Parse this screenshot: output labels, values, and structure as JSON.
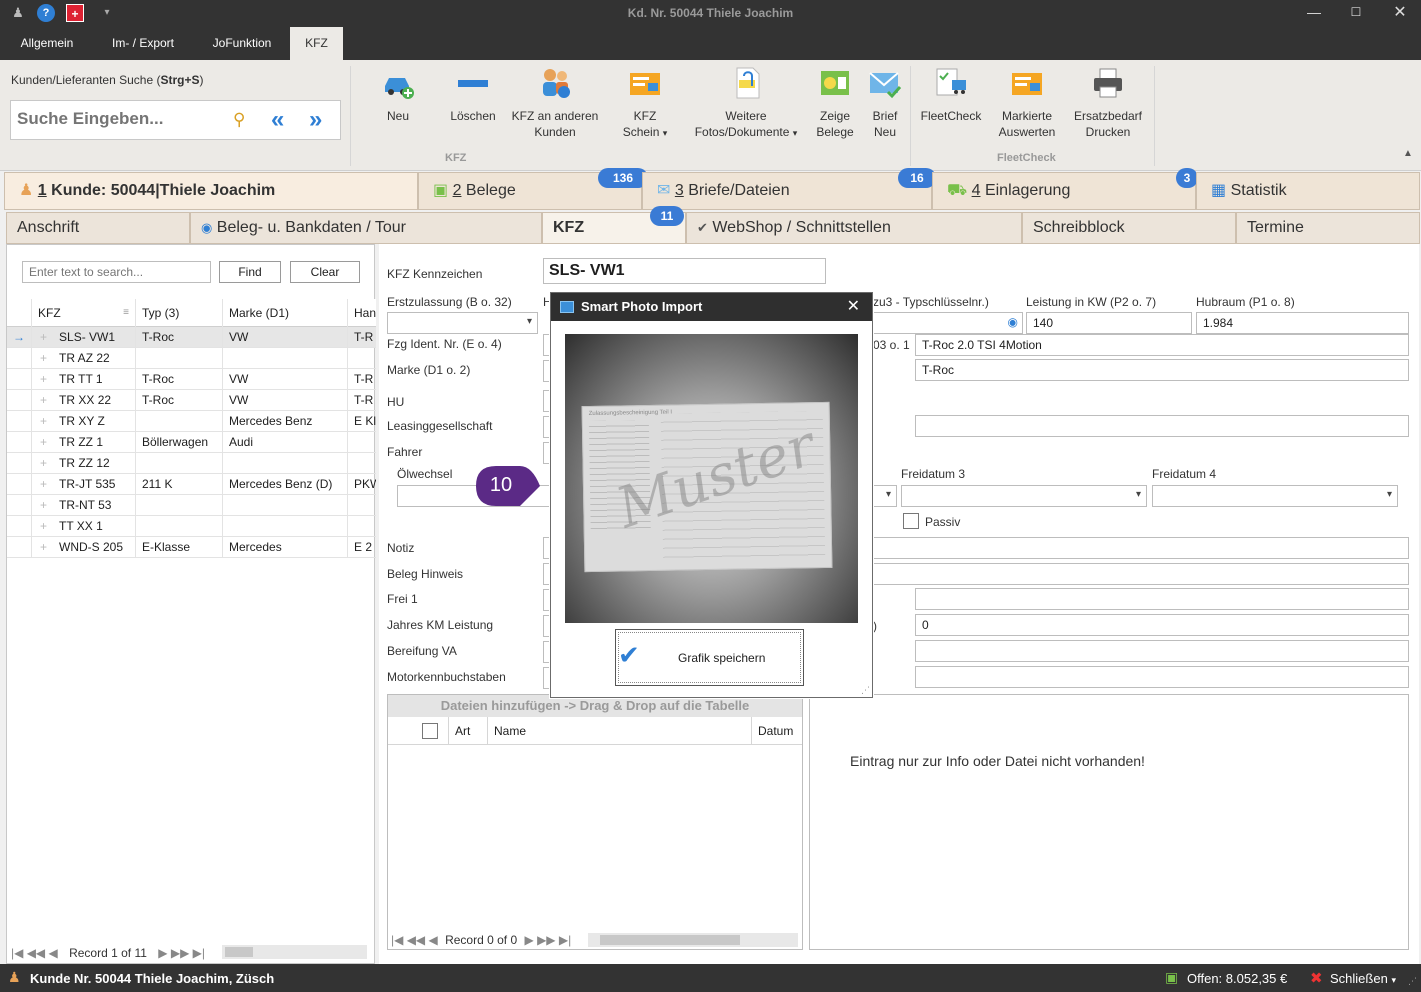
{
  "window": {
    "title": "Kd. Nr. 50044 Thiele Joachim"
  },
  "menu": {
    "tabs": [
      "Allgemein",
      "Im- / Export",
      "JoFunktion",
      "KFZ"
    ]
  },
  "ribbon": {
    "search_label_prefix": "Kunden/Lieferanten Suche (",
    "search_label_shortcut": "Strg+S",
    "search_label_suffix": ")",
    "search_placeholder": "Suche Eingeben...",
    "kfz_group": "KFZ",
    "fleet_group": "FleetCheck",
    "buttons": {
      "neu": "Neu",
      "loeschen": "Löschen",
      "kfz_an1": "KFZ an anderen",
      "kfz_an2": "Kunden",
      "schein": "KFZ Schein",
      "weitere1": "Weitere",
      "weitere2": "Fotos/Dokumente",
      "zeige1": "Zeige",
      "zeige2": "Belege",
      "brief1": "Brief",
      "brief2": "Neu",
      "fleetcheck": "FleetCheck",
      "markierte1": "Markierte",
      "markierte2": "Auswerten",
      "ersatz1": "Ersatzbedarf",
      "ersatz2": "Drucken"
    }
  },
  "main_tabs": {
    "kunde_num": "1",
    "kunde_text": " Kunde: 50044|Thiele Joachim",
    "belege_num": "2",
    "belege_text": " Belege",
    "belege_badge": "136",
    "briefe_num": "3",
    "briefe_text": " Briefe/Dateien",
    "briefe_badge": "16",
    "einl_num": "4",
    "einl_text": " Einlagerung",
    "einl_badge": "3",
    "statistik": "Statistik"
  },
  "sub_tabs": {
    "anschrift": "Anschrift",
    "beleg": "Beleg- u. Bankdaten / Tour",
    "kfz": "KFZ",
    "kfz_badge": "11",
    "webshop": "WebShop / Schnittstellen",
    "schreibblock": "Schreibblock",
    "termine": "Termine"
  },
  "left_panel": {
    "search_placeholder": "Enter text to search...",
    "find": "Find",
    "clear": "Clear",
    "columns": [
      "KFZ",
      "Typ (3)",
      "Marke (D1)",
      "Han"
    ],
    "rows": [
      [
        "SLS- VW1",
        "T-Roc",
        "VW",
        "T-R"
      ],
      [
        "TR AZ 22",
        "",
        "",
        ""
      ],
      [
        "TR TT 1",
        "T-Roc",
        "VW",
        "T-R"
      ],
      [
        "TR XX 22",
        "T-Roc",
        "VW",
        "T-R"
      ],
      [
        "TR XY Z",
        "",
        "Mercedes Benz",
        "E Kl"
      ],
      [
        "TR ZZ 1",
        "Böllerwagen",
        "Audi",
        ""
      ],
      [
        "TR ZZ 12",
        "",
        "",
        ""
      ],
      [
        "TR-JT 535",
        "211 K",
        "Mercedes Benz (D)",
        "PKW"
      ],
      [
        "TR-NT 53",
        "",
        "",
        ""
      ],
      [
        "TT XX 1",
        "",
        "",
        ""
      ],
      [
        "WND-S 205",
        "E-Klasse",
        "Mercedes",
        "E 2"
      ]
    ],
    "record_nav": "Record 1 of 11"
  },
  "form": {
    "kennzeichen_label": "KFZ Kennzeichen",
    "kennzeichen": "SLS- VW1",
    "erstzulassung_label": "Erstzulassung (B o. 32)",
    "h_label": "H",
    "typschluessel_label": "zu3 - Typschlüsselnr.)",
    "leistung_label": "Leistung in KW (P2 o. 7)",
    "leistung": "140",
    "hubraum_label": "Hubraum (P1 o. 8)",
    "hubraum": "1.984",
    "fzg_label": "Fzg Ident. Nr. (E o. 4)",
    "d3_label": "03 o. 1",
    "d3_value": "T-Roc 2.0 TSI 4Motion",
    "marke_label": "Marke (D1 o. 2)",
    "marke_right": "T-Roc",
    "hu_label": "HU",
    "leasing_label": "Leasinggesellschaft",
    "fahrer_label": "Fahrer",
    "oelwechsel_label": "Ölwechsel",
    "freidatum3_label": "Freidatum 3",
    "freidatum4_label": "Freidatum 4",
    "passiv_label": "Passiv",
    "notiz_label": "Notiz",
    "beleg_hinweis_label": "Beleg Hinweis",
    "frei1_label": "Frei 1",
    "jahres_km_label": "Jahres KM Leistung",
    "jahres_km_right_label": ")",
    "jahres_km_right": "0",
    "bereifung_label": "Bereifung VA",
    "motor_label": "Motorkennbuchstaben"
  },
  "files": {
    "drag_hint": "Dateien hinzufügen -> Drag & Drop auf die Tabelle",
    "columns": [
      "Art",
      "Name",
      "Datum"
    ],
    "record_nav": "Record 0 of 0",
    "preview_text": "Eintrag nur zur Info oder Datei nicht vorhanden!"
  },
  "callout": {
    "number": "10"
  },
  "dialog": {
    "title": "Smart Photo Import",
    "save_button": "Grafik speichern",
    "photo_heading": "Zulassungsbescheinigung Teil I",
    "photo_watermark": "Muster"
  },
  "statusbar": {
    "left": "Kunde Nr. 50044 Thiele Joachim, Züsch",
    "offen": "Offen: 8.052,35 €",
    "schliessen": "Schließen"
  },
  "colors": {
    "accent": "#3a7bd5",
    "titlebar": "#333333",
    "tab": "#efe4d6",
    "callout": "#5b2a86"
  }
}
